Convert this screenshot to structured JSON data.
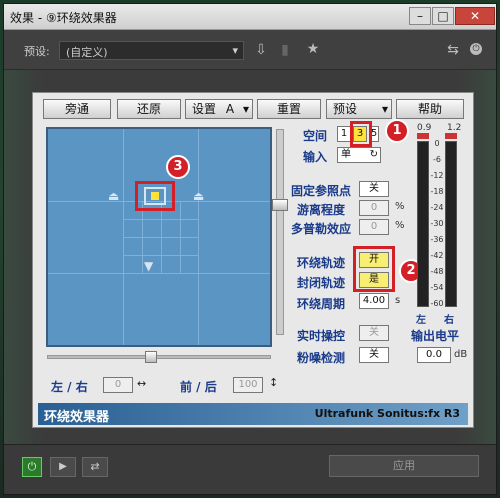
{
  "window": {
    "title": "效果 - ⑨环绕效果器",
    "min": "–",
    "max": "□",
    "close": "✕"
  },
  "preset": {
    "label": "预设:",
    "value": "(自定义)"
  },
  "toolbar": {
    "buttons": [
      "旁通",
      "还原",
      "设置",
      "重置",
      "预设",
      "帮助"
    ],
    "setting_value": "A"
  },
  "panel": {
    "space_label": "空间",
    "space_vals": [
      "1",
      "3",
      "5"
    ],
    "input_label": "输入",
    "input_value": "单",
    "fixed_label": "固定参照点",
    "fixed_btn": "关",
    "drift_label": "游离程度",
    "drift_value": "0",
    "drift_unit": "%",
    "doppler_label": "多普勒效应",
    "doppler_value": "0",
    "doppler_unit": "%",
    "track_label": "环绕轨迹",
    "track_btn": "开",
    "closed_label": "封闭轨迹",
    "closed_btn": "是",
    "period_label": "环绕周期",
    "period_value": "4.00",
    "period_unit": "s",
    "realtime_label": "实时操控",
    "realtime_btn": "关",
    "pink_label": "粉噪检测",
    "pink_btn": "关",
    "output_label": "输出电平",
    "output_value": "0.0",
    "output_unit": "dB",
    "lr_label": "左 / 右",
    "lr_value": "0",
    "fb_label": "前 / 后",
    "fb_value": "100",
    "meter_top": [
      "0.9",
      "1.2"
    ],
    "meter_scale": [
      "0",
      "-6",
      "-12",
      "-18",
      "-24",
      "-30",
      "-36",
      "-42",
      "-48",
      "-54",
      "-60"
    ],
    "meter_bottom": [
      "左",
      "右"
    ],
    "footer_left": "环绕效果器",
    "footer_right": "Ultrafunk Sonitus:fx R3",
    "badges": [
      "1",
      "2",
      "3"
    ]
  },
  "bottom": {
    "apply": "应用"
  }
}
